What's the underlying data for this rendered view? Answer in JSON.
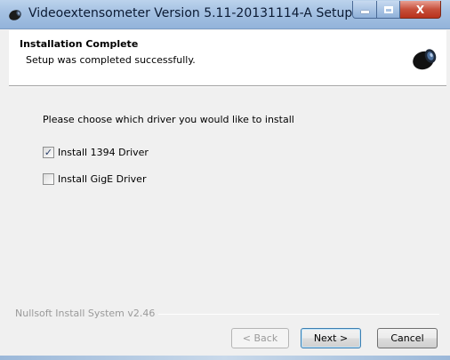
{
  "window": {
    "title": "Videoextensometer Version 5.11-20131114-A Setup",
    "app_icon": "camera-icon",
    "controls": [
      "minimize-icon",
      "maximize-icon",
      "close-icon"
    ],
    "close_glyph": "X"
  },
  "header": {
    "title": "Installation Complete",
    "subtitle": "Setup was completed successfully.",
    "logo": "camera-lens-icon"
  },
  "main": {
    "prompt": "Please choose which driver you would like to install",
    "options": [
      {
        "label": "Install 1394 Driver",
        "checked": true,
        "check_glyph": "✓"
      },
      {
        "label": "Install GigE Driver",
        "checked": false,
        "check_glyph": ""
      }
    ]
  },
  "footer": {
    "brand": "Nullsoft Install System v2.46",
    "buttons": {
      "back": "< Back",
      "next": "Next >",
      "cancel": "Cancel"
    }
  },
  "colors": {
    "titlebar": "#a6c2e3",
    "close_button": "#c7503b",
    "default_button_border": "#3c7fb1"
  }
}
